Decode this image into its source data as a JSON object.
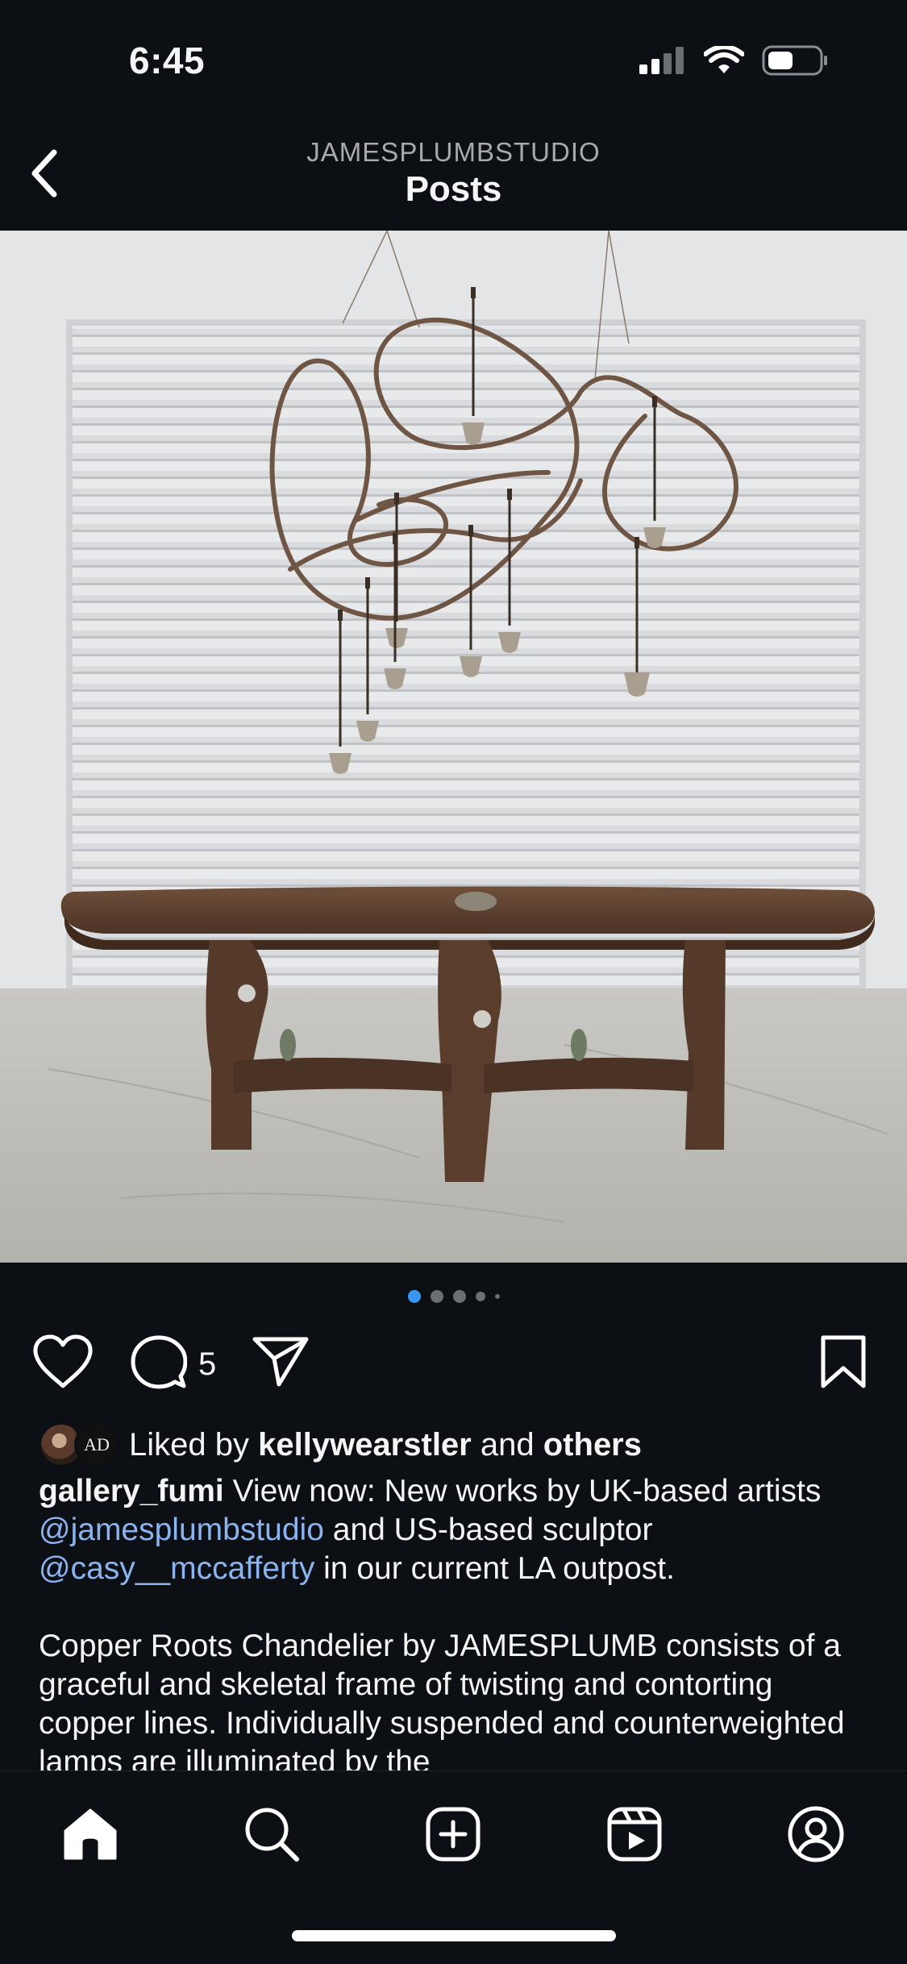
{
  "status_bar": {
    "time": "6:45",
    "icons": [
      "signal-icon",
      "wifi-icon",
      "battery-icon"
    ]
  },
  "header": {
    "subtitle": "JAMESPLUMBSTUDIO",
    "title": "Posts",
    "back_icon": "chevron-left-icon"
  },
  "post": {
    "image_icon": "post-photo",
    "carousel": {
      "count": 5,
      "active_index": 0,
      "accent": "#3897f0"
    },
    "actions": {
      "like_icon": "heart-icon",
      "comment_icon": "comment-icon",
      "comment_count": "5",
      "share_icon": "paper-plane-icon",
      "save_icon": "bookmark-icon"
    },
    "likes": {
      "prefix": "Liked by",
      "user": "kellywearstler",
      "joiner": "and",
      "others": "others",
      "avatar_2_text": "AD"
    },
    "caption": {
      "username": "gallery_fumi",
      "text_1": "View now: New works by UK-based artists",
      "mention_1": "@jamesplumbstudio",
      "text_2": "and US-based sculptor",
      "mention_2": "@casy__mccafferty",
      "text_3": "in our current LA outpost.",
      "paragraph_2": "Copper Roots Chandelier by JAMESPLUMB consists of a graceful and skeletal frame of twisting and contorting copper lines. Individually suspended and counterweighted lamps are illuminated by the"
    }
  },
  "bottom_nav": {
    "items": [
      "home-icon",
      "search-icon",
      "create-icon",
      "reels-icon",
      "profile-icon"
    ]
  },
  "colors": {
    "background": "#0c0f14",
    "text": "#f5f5f5",
    "mention": "#8ab4f0",
    "muted": "#a7a9ad"
  }
}
